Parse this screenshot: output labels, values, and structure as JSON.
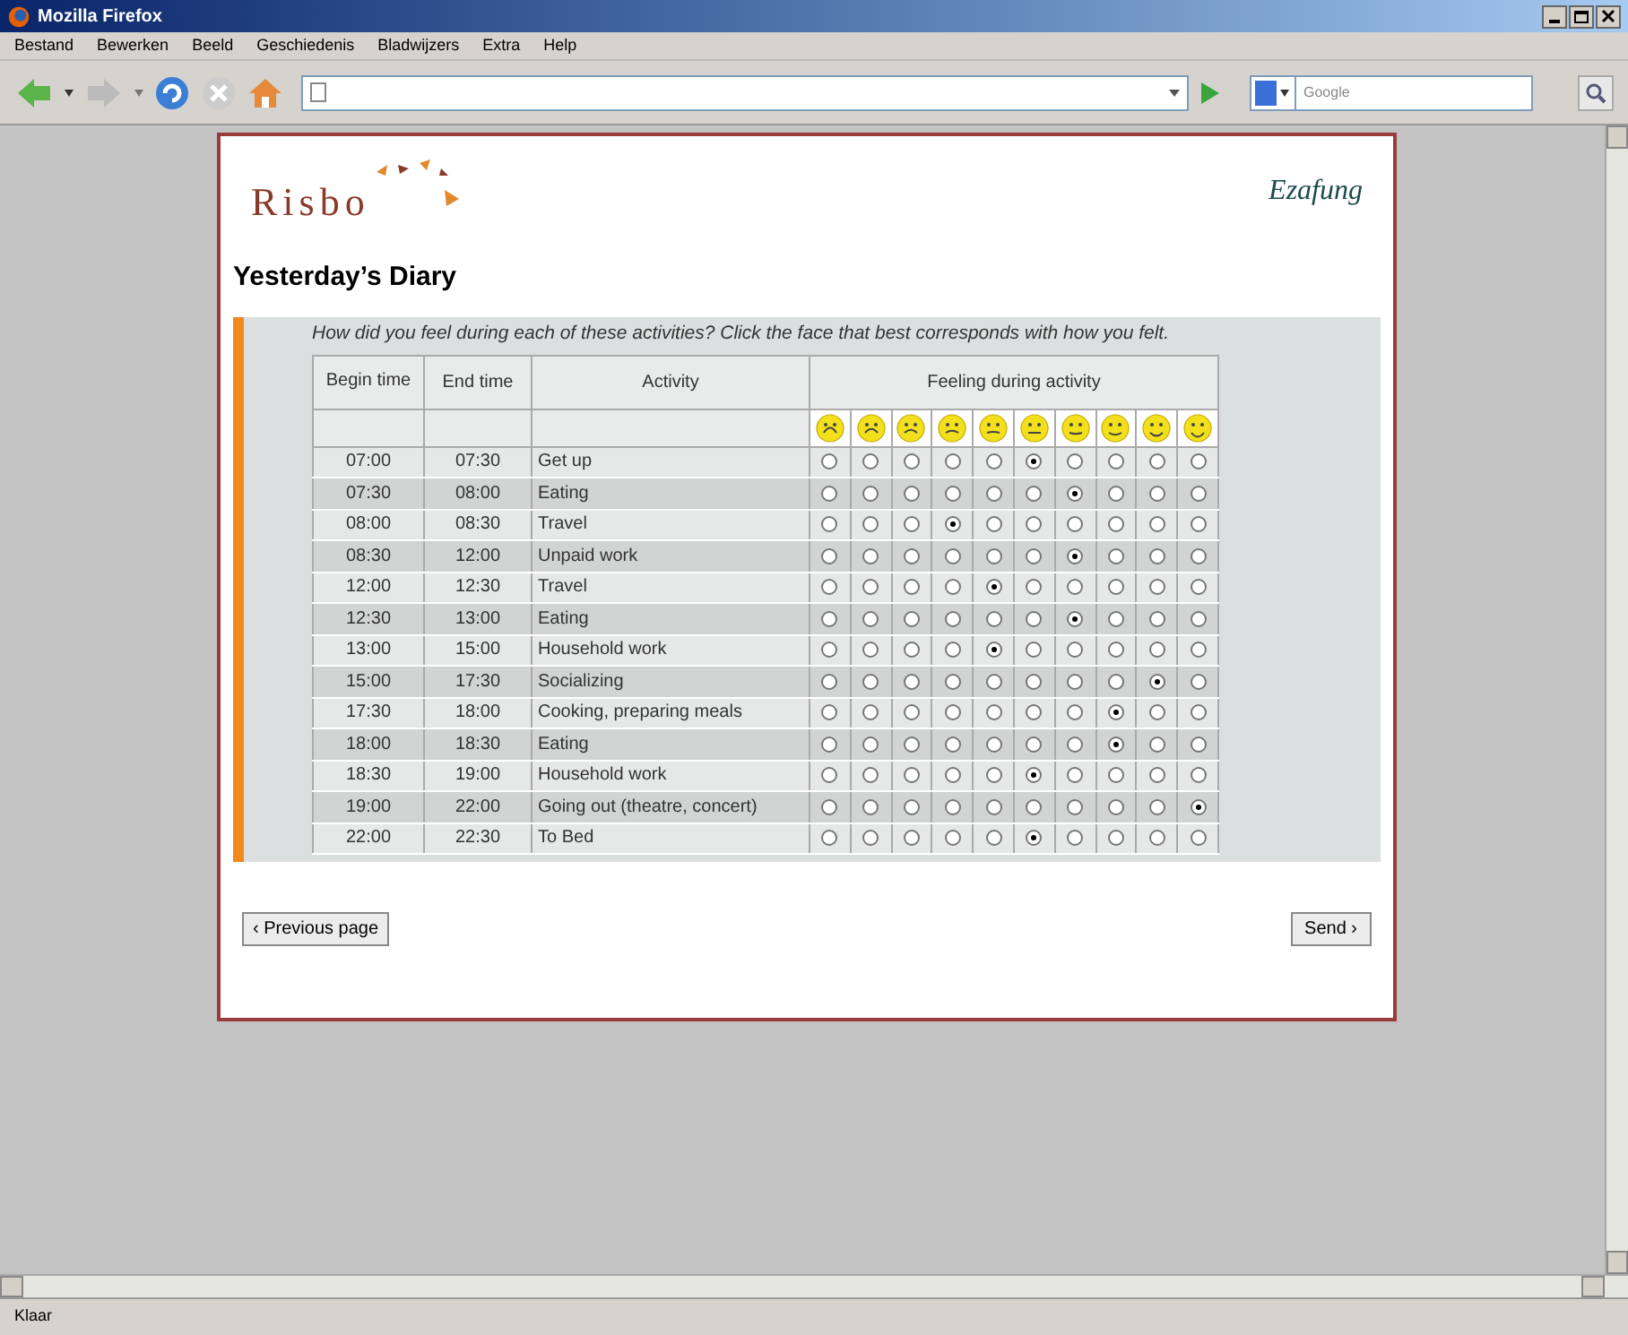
{
  "window": {
    "title": "Mozilla Firefox"
  },
  "menu": [
    "Bestand",
    "Bewerken",
    "Beeld",
    "Geschiedenis",
    "Bladwijzers",
    "Extra",
    "Help"
  ],
  "search": {
    "placeholder": "Google"
  },
  "page": {
    "logo": "Risbo",
    "logo_right": "Ezafung",
    "title": "Yesterday’s Diary",
    "question": "How did you feel during each of these activities? Click the face that best corresponds with how you felt.",
    "columns": [
      "Begin time",
      "End time",
      "Activity",
      "Feeling during activity"
    ],
    "rows": [
      {
        "begin": "07:00",
        "end": "07:30",
        "activity": "Get up",
        "feelings": [
          {
            "selected": false
          },
          {
            "selected": false
          },
          {
            "selected": false
          },
          {
            "selected": false
          },
          {
            "selected": false
          },
          {
            "selected": true
          },
          {
            "selected": false
          },
          {
            "selected": false
          },
          {
            "selected": false
          },
          {
            "selected": false
          }
        ]
      },
      {
        "begin": "07:30",
        "end": "08:00",
        "activity": "Eating",
        "feelings": [
          {
            "selected": false
          },
          {
            "selected": false
          },
          {
            "selected": false
          },
          {
            "selected": false
          },
          {
            "selected": false
          },
          {
            "selected": false
          },
          {
            "selected": true
          },
          {
            "selected": false
          },
          {
            "selected": false
          },
          {
            "selected": false
          }
        ]
      },
      {
        "begin": "08:00",
        "end": "08:30",
        "activity": "Travel",
        "feelings": [
          {
            "selected": false
          },
          {
            "selected": false
          },
          {
            "selected": false
          },
          {
            "selected": true
          },
          {
            "selected": false
          },
          {
            "selected": false
          },
          {
            "selected": false
          },
          {
            "selected": false
          },
          {
            "selected": false
          },
          {
            "selected": false
          }
        ]
      },
      {
        "begin": "08:30",
        "end": "12:00",
        "activity": "Unpaid work",
        "feelings": [
          {
            "selected": false
          },
          {
            "selected": false
          },
          {
            "selected": false
          },
          {
            "selected": false
          },
          {
            "selected": false
          },
          {
            "selected": false
          },
          {
            "selected": true
          },
          {
            "selected": false
          },
          {
            "selected": false
          },
          {
            "selected": false
          }
        ]
      },
      {
        "begin": "12:00",
        "end": "12:30",
        "activity": "Travel",
        "feelings": [
          {
            "selected": false
          },
          {
            "selected": false
          },
          {
            "selected": false
          },
          {
            "selected": false
          },
          {
            "selected": true
          },
          {
            "selected": false
          },
          {
            "selected": false
          },
          {
            "selected": false
          },
          {
            "selected": false
          },
          {
            "selected": false
          }
        ]
      },
      {
        "begin": "12:30",
        "end": "13:00",
        "activity": "Eating",
        "feelings": [
          {
            "selected": false
          },
          {
            "selected": false
          },
          {
            "selected": false
          },
          {
            "selected": false
          },
          {
            "selected": false
          },
          {
            "selected": false
          },
          {
            "selected": true
          },
          {
            "selected": false
          },
          {
            "selected": false
          },
          {
            "selected": false
          }
        ]
      },
      {
        "begin": "13:00",
        "end": "15:00",
        "activity": "Household work",
        "feelings": [
          {
            "selected": false
          },
          {
            "selected": false
          },
          {
            "selected": false
          },
          {
            "selected": false
          },
          {
            "selected": true
          },
          {
            "selected": false
          },
          {
            "selected": false
          },
          {
            "selected": false
          },
          {
            "selected": false
          },
          {
            "selected": false
          }
        ]
      },
      {
        "begin": "15:00",
        "end": "17:30",
        "activity": "Socializing",
        "feelings": [
          {
            "selected": false
          },
          {
            "selected": false
          },
          {
            "selected": false
          },
          {
            "selected": false
          },
          {
            "selected": false
          },
          {
            "selected": false
          },
          {
            "selected": false
          },
          {
            "selected": false
          },
          {
            "selected": true
          },
          {
            "selected": false
          }
        ]
      },
      {
        "begin": "17:30",
        "end": "18:00",
        "activity": "Cooking, preparing meals",
        "feelings": [
          {
            "selected": false
          },
          {
            "selected": false
          },
          {
            "selected": false
          },
          {
            "selected": false
          },
          {
            "selected": false
          },
          {
            "selected": false
          },
          {
            "selected": false
          },
          {
            "selected": true
          },
          {
            "selected": false
          },
          {
            "selected": false
          }
        ]
      },
      {
        "begin": "18:00",
        "end": "18:30",
        "activity": "Eating",
        "feelings": [
          {
            "selected": false
          },
          {
            "selected": false
          },
          {
            "selected": false
          },
          {
            "selected": false
          },
          {
            "selected": false
          },
          {
            "selected": false
          },
          {
            "selected": false
          },
          {
            "selected": true
          },
          {
            "selected": false
          },
          {
            "selected": false
          }
        ]
      },
      {
        "begin": "18:30",
        "end": "19:00",
        "activity": "Household work",
        "feelings": [
          {
            "selected": false
          },
          {
            "selected": false
          },
          {
            "selected": false
          },
          {
            "selected": false
          },
          {
            "selected": false
          },
          {
            "selected": true
          },
          {
            "selected": false
          },
          {
            "selected": false
          },
          {
            "selected": false
          },
          {
            "selected": false
          }
        ]
      },
      {
        "begin": "19:00",
        "end": "22:00",
        "activity": "Going out (theatre, concert)",
        "feelings": [
          {
            "selected": false
          },
          {
            "selected": false
          },
          {
            "selected": false
          },
          {
            "selected": false
          },
          {
            "selected": false
          },
          {
            "selected": false
          },
          {
            "selected": false
          },
          {
            "selected": false
          },
          {
            "selected": false
          },
          {
            "selected": true
          }
        ]
      },
      {
        "begin": "22:00",
        "end": "22:30",
        "activity": "To Bed",
        "feelings": [
          {
            "selected": false
          },
          {
            "selected": false
          },
          {
            "selected": false
          },
          {
            "selected": false
          },
          {
            "selected": false
          },
          {
            "selected": true
          },
          {
            "selected": false
          },
          {
            "selected": false
          },
          {
            "selected": false
          },
          {
            "selected": false
          }
        ]
      }
    ],
    "buttons": [
      "‹ Previous page",
      "Send ›"
    ]
  },
  "status_bar": "Klaar"
}
